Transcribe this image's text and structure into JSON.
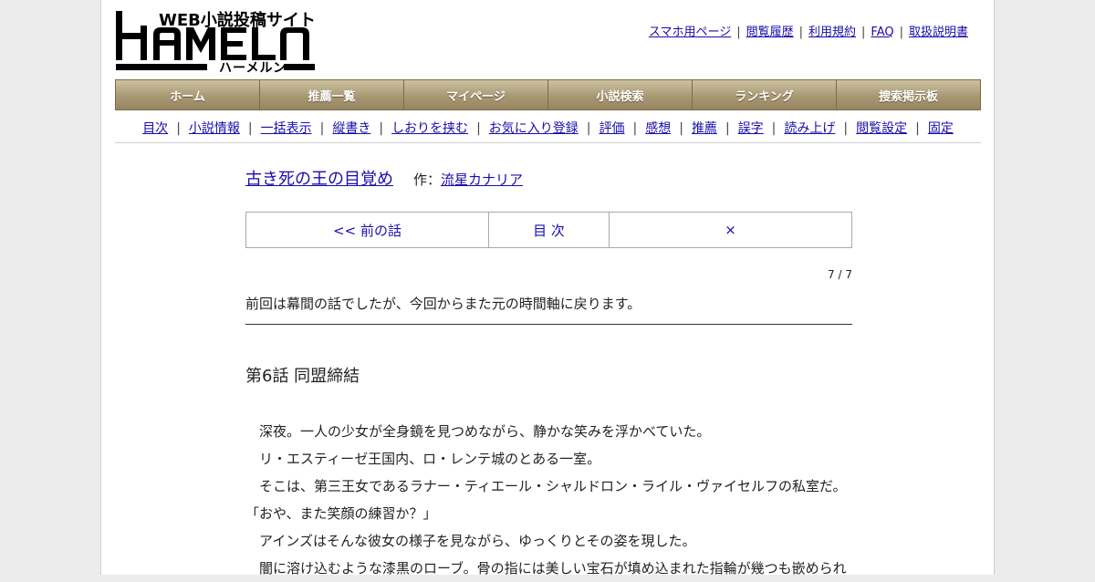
{
  "logo": {
    "tagline": "WEB小説投稿サイト",
    "wordmark": "HAMELN",
    "kana": "ハーメルン"
  },
  "top_links": [
    {
      "label": "スマホ用ページ"
    },
    {
      "label": "閲覧履歴"
    },
    {
      "label": "利用規約"
    },
    {
      "label": "FAQ"
    },
    {
      "label": "取扱説明書"
    }
  ],
  "main_nav": [
    {
      "label": "ホーム"
    },
    {
      "label": "推薦一覧"
    },
    {
      "label": "マイページ"
    },
    {
      "label": "小説検索"
    },
    {
      "label": "ランキング"
    },
    {
      "label": "捜索掲示板"
    }
  ],
  "sub_nav": [
    {
      "label": "目次"
    },
    {
      "label": "小説情報"
    },
    {
      "label": "一括表示"
    },
    {
      "label": "縦書き"
    },
    {
      "label": "しおりを挟む"
    },
    {
      "label": "お気に入り登録"
    },
    {
      "label": "評価"
    },
    {
      "label": "感想"
    },
    {
      "label": "推薦"
    },
    {
      "label": "誤字"
    },
    {
      "label": "読み上げ"
    },
    {
      "label": "閲覧設定"
    },
    {
      "label": "固定"
    }
  ],
  "novel": {
    "title": "古き死の王の目覚め",
    "author_label": "作：",
    "author": "流星カナリア"
  },
  "pager": {
    "prev": "<< 前の話",
    "toc": "目 次",
    "next": "×"
  },
  "page_count": "7 / 7",
  "preface": "前回は幕間の話でしたが、今回からまた元の時間軸に戻ります。",
  "chapter_title": "第6話 同盟締結",
  "body_lines": [
    "　深夜。一人の少女が全身鏡を見つめながら、静かな笑みを浮かべていた。",
    "　リ・エスティーゼ王国内、ロ・レンテ城のとある一室。",
    "　そこは、第三王女であるラナー・ティエール・シャルドロン・ライル・ヴァイセルフの私室だ。",
    "「おや、また笑顔の練習か？」",
    "　アインズはそんな彼女の様子を見ながら、ゆっくりとその姿を現した。",
    "　闇に溶け込むような漆黒のローブ。骨の指には美しい宝石が填め込まれた指輪が幾つも嵌められ"
  ]
}
